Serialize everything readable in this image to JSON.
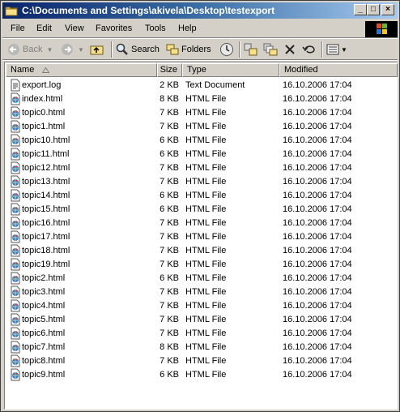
{
  "window": {
    "title": "C:\\Documents and Settings\\akivela\\Desktop\\testexport",
    "controls": [
      "_",
      "□",
      "×"
    ]
  },
  "menu": [
    "File",
    "Edit",
    "View",
    "Favorites",
    "Tools",
    "Help"
  ],
  "toolbar": {
    "back": "Back",
    "search": "Search",
    "folders": "Folders"
  },
  "columns": {
    "name": "Name",
    "size": "Size",
    "type": "Type",
    "modified": "Modified"
  },
  "files": [
    {
      "name": "export.log",
      "size": "2 KB",
      "type": "Text Document",
      "modified": "16.10.2006 17:04",
      "icon": "text-file-icon"
    },
    {
      "name": "index.html",
      "size": "8 KB",
      "type": "HTML File",
      "modified": "16.10.2006 17:04",
      "icon": "html-file-icon"
    },
    {
      "name": "topic0.html",
      "size": "7 KB",
      "type": "HTML File",
      "modified": "16.10.2006 17:04",
      "icon": "html-file-icon"
    },
    {
      "name": "topic1.html",
      "size": "7 KB",
      "type": "HTML File",
      "modified": "16.10.2006 17:04",
      "icon": "html-file-icon"
    },
    {
      "name": "topic10.html",
      "size": "6 KB",
      "type": "HTML File",
      "modified": "16.10.2006 17:04",
      "icon": "html-file-icon"
    },
    {
      "name": "topic11.html",
      "size": "6 KB",
      "type": "HTML File",
      "modified": "16.10.2006 17:04",
      "icon": "html-file-icon"
    },
    {
      "name": "topic12.html",
      "size": "7 KB",
      "type": "HTML File",
      "modified": "16.10.2006 17:04",
      "icon": "html-file-icon"
    },
    {
      "name": "topic13.html",
      "size": "7 KB",
      "type": "HTML File",
      "modified": "16.10.2006 17:04",
      "icon": "html-file-icon"
    },
    {
      "name": "topic14.html",
      "size": "6 KB",
      "type": "HTML File",
      "modified": "16.10.2006 17:04",
      "icon": "html-file-icon"
    },
    {
      "name": "topic15.html",
      "size": "6 KB",
      "type": "HTML File",
      "modified": "16.10.2006 17:04",
      "icon": "html-file-icon"
    },
    {
      "name": "topic16.html",
      "size": "7 KB",
      "type": "HTML File",
      "modified": "16.10.2006 17:04",
      "icon": "html-file-icon"
    },
    {
      "name": "topic17.html",
      "size": "7 KB",
      "type": "HTML File",
      "modified": "16.10.2006 17:04",
      "icon": "html-file-icon"
    },
    {
      "name": "topic18.html",
      "size": "7 KB",
      "type": "HTML File",
      "modified": "16.10.2006 17:04",
      "icon": "html-file-icon"
    },
    {
      "name": "topic19.html",
      "size": "7 KB",
      "type": "HTML File",
      "modified": "16.10.2006 17:04",
      "icon": "html-file-icon"
    },
    {
      "name": "topic2.html",
      "size": "6 KB",
      "type": "HTML File",
      "modified": "16.10.2006 17:04",
      "icon": "html-file-icon"
    },
    {
      "name": "topic3.html",
      "size": "7 KB",
      "type": "HTML File",
      "modified": "16.10.2006 17:04",
      "icon": "html-file-icon"
    },
    {
      "name": "topic4.html",
      "size": "7 KB",
      "type": "HTML File",
      "modified": "16.10.2006 17:04",
      "icon": "html-file-icon"
    },
    {
      "name": "topic5.html",
      "size": "7 KB",
      "type": "HTML File",
      "modified": "16.10.2006 17:04",
      "icon": "html-file-icon"
    },
    {
      "name": "topic6.html",
      "size": "7 KB",
      "type": "HTML File",
      "modified": "16.10.2006 17:04",
      "icon": "html-file-icon"
    },
    {
      "name": "topic7.html",
      "size": "8 KB",
      "type": "HTML File",
      "modified": "16.10.2006 17:04",
      "icon": "html-file-icon"
    },
    {
      "name": "topic8.html",
      "size": "7 KB",
      "type": "HTML File",
      "modified": "16.10.2006 17:04",
      "icon": "html-file-icon"
    },
    {
      "name": "topic9.html",
      "size": "6 KB",
      "type": "HTML File",
      "modified": "16.10.2006 17:04",
      "icon": "html-file-icon"
    }
  ]
}
